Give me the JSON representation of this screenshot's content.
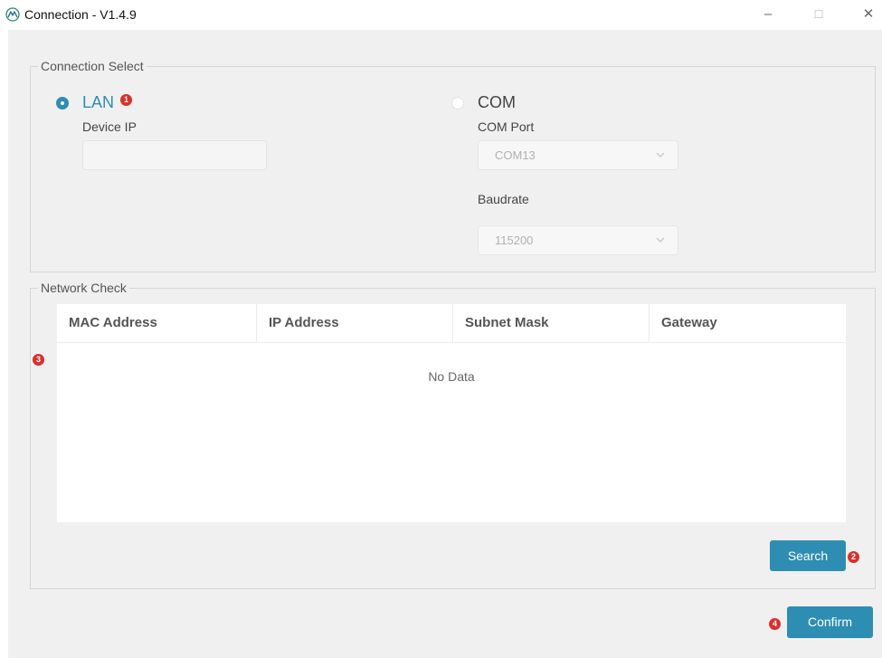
{
  "window": {
    "title": "Connection - V1.4.9",
    "app_icon": "mountain-logo-icon",
    "controls": {
      "minimize": "–",
      "maximize": "☐",
      "close": "✕"
    }
  },
  "connection_select": {
    "legend": "Connection Select",
    "lan": {
      "label": "LAN",
      "selected": true,
      "field_label": "Device IP",
      "ip_value": "",
      "badge": "1"
    },
    "com": {
      "label": "COM",
      "selected": false,
      "port_label": "COM Port",
      "port_value": "COM13",
      "baud_label": "Baudrate",
      "baud_value": "115200"
    }
  },
  "network_check": {
    "legend": "Network Check",
    "badge": "3",
    "columns": [
      "MAC Address",
      "IP Address",
      "Subnet Mask",
      "Gateway"
    ],
    "rows": [],
    "empty_text": "No Data",
    "search_label": "Search",
    "search_badge": "2"
  },
  "footer": {
    "confirm_label": "Confirm",
    "confirm_badge": "4"
  },
  "colors": {
    "accent": "#2e8db3",
    "badge": "#d9302b",
    "panel": "#f0f0f0"
  }
}
